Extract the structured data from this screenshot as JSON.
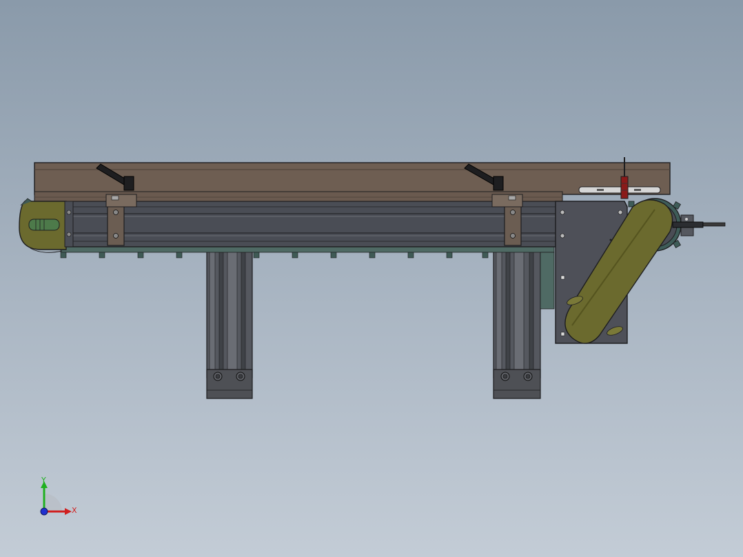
{
  "viewport": {
    "background_top": "#8a9aaa",
    "background_bottom": "#c3ccd6"
  },
  "model": {
    "belt_color": "#6e5e52",
    "frame_color": "#4a4d55",
    "bracket_color": "#6b5d52",
    "motor_cover_color": "#6b6a2e",
    "sensor_color": "#8a1a1a"
  },
  "triad": {
    "x_label": "X",
    "y_label": "Y",
    "x_color": "#d02020",
    "y_color": "#20b020",
    "z_color": "#2030d0"
  }
}
